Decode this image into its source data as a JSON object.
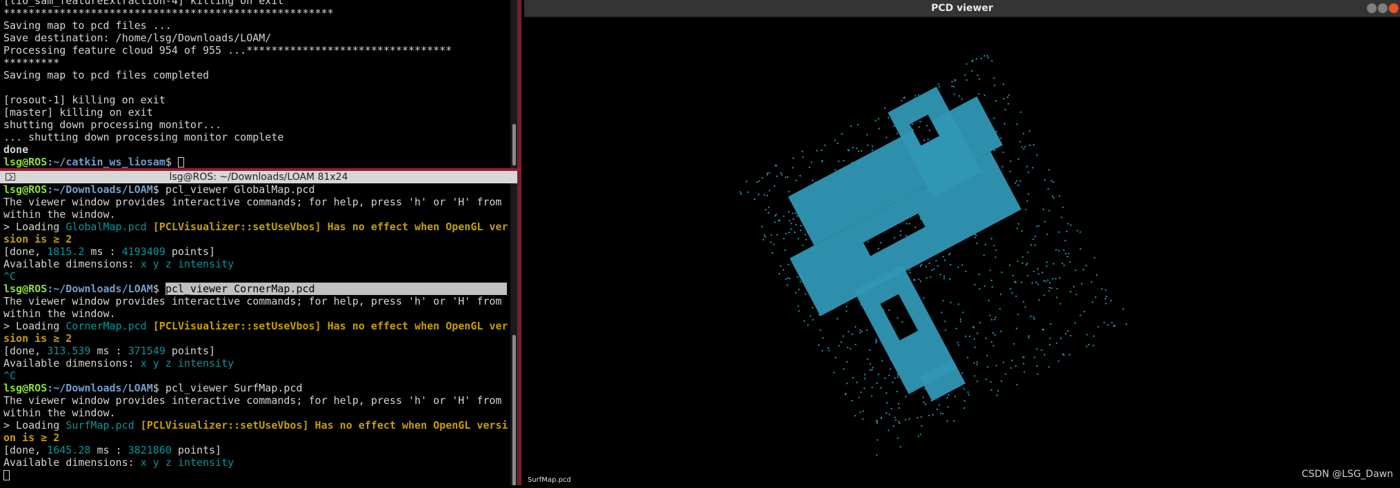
{
  "top_terminal": {
    "lines": [
      "[lio_sam_featureExtraction-4] killing on exit",
      "*****************************************************",
      "Saving map to pcd files ...",
      "Save destination: /home/lsg/Downloads/LOAM/",
      "Processing feature cloud 954 of 955 ...*********************************",
      "*********",
      "Saving map to pcd files completed",
      "",
      "[rosout-1] killing on exit",
      "[master] killing on exit",
      "shutting down processing monitor...",
      "... shutting down processing monitor complete",
      "done"
    ],
    "prompt_user": "lsg@ROS",
    "prompt_path": ":~/catkin_ws_liosam",
    "prompt_symbol": "$ "
  },
  "bottom_terminal": {
    "title": "lsg@ROS: ~/Downloads/LOAM 81x24",
    "prompt_user": "lsg@ROS",
    "prompt_path": ":~/Downloads/LOAM",
    "prompt_symbol": "$ ",
    "cmd1": "pcl_viewer GlobalMap.pcd",
    "cmd2": "pcl_viewer CornerMap.pcd",
    "cmd3": "pcl_viewer SurfMap.pcd",
    "help_line_1": "The viewer window provides interactive commands; for help, press 'h' or 'H' from",
    "help_line_2": "within the window.",
    "loading_prefix": "> Loading ",
    "file1": "GlobalMap.pcd",
    "file2": "CornerMap.pcd",
    "file3": "SurfMap.pcd",
    "warn1": " [PCLVisualizer::setUseVbos] Has no effect when OpenGL ver",
    "warn1_cont": "sion is ≥ 2",
    "warn3": " [PCLVisualizer::setUseVbos] Has no effect when OpenGL versi",
    "warn3_cont": "on is ≥ 2",
    "done_prefix": "[done, ",
    "ms_text": " ms : ",
    "points_text": " points]",
    "ms1": "1815.2",
    "pts1": "4193409",
    "ms2": "313.539",
    "pts2": "371549",
    "ms3": "1645.28",
    "pts3": "3821860",
    "dims_prefix": "Available dimensions: ",
    "dims": "x y z intensity",
    "ctrl_c": "^C"
  },
  "pcd_viewer": {
    "title": "PCD viewer",
    "cloud_label": "SurfMap.pcd",
    "watermark": "CSDN @LSG_Dawn",
    "point_color": "#2f97b4"
  },
  "colors": {
    "prompt_user": "#8ae234",
    "prompt_path": "#729fcf",
    "cyan": "#06989a",
    "warning": "#c4a000",
    "separator": "#8b2131"
  }
}
